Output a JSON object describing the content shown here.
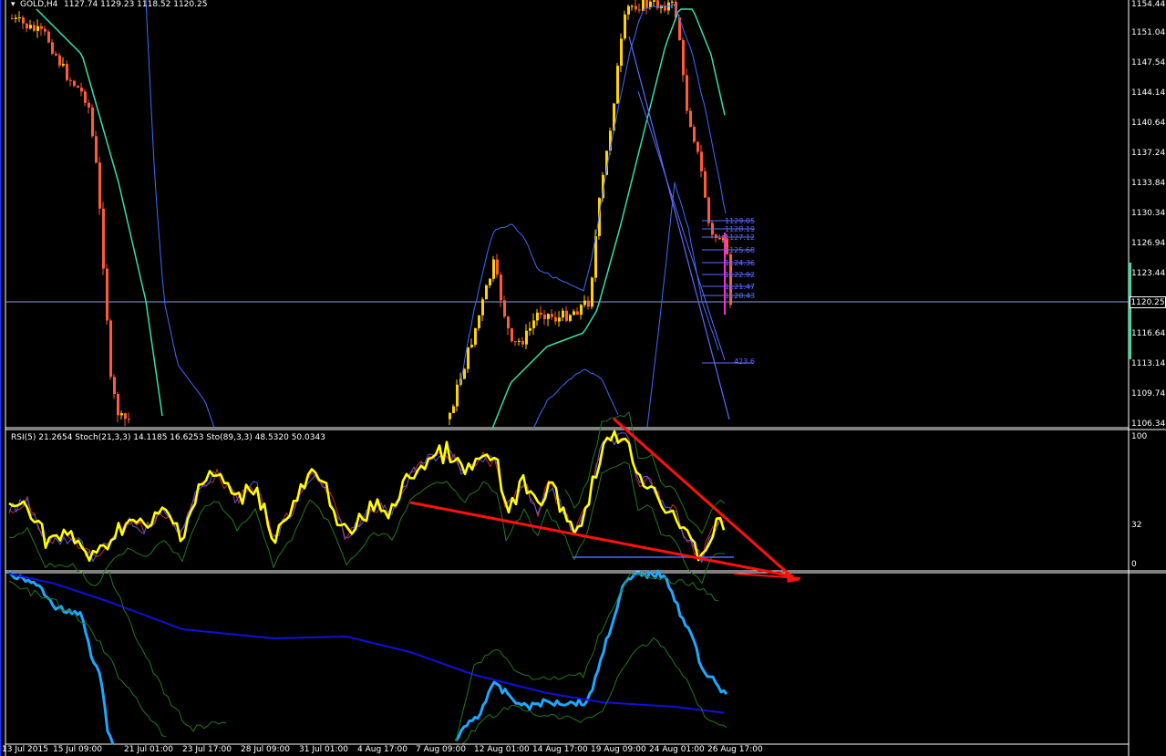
{
  "window": {
    "title": "GOLD,H4",
    "ohlc": "1127.74 1129.23 1118.52 1120.25",
    "arrow_icon": "caret-down-icon"
  },
  "price_axis": {
    "labels": [
      "1154.44",
      "1151.04",
      "1147.54",
      "1144.14",
      "1140.64",
      "1137.24",
      "1133.84",
      "1130.34",
      "1126.94",
      "1123.44",
      "1116.64",
      "1113.14",
      "1109.74",
      "1106.34"
    ],
    "current_price": "1120.25"
  },
  "oscillator_panel": {
    "title": "RSI(5) 21.2654  Stoch(21,3,3) 14.1185 16.6253  Sto(89,3,3) 48.5320 50.0343",
    "levels": [
      "100",
      "32",
      "0"
    ]
  },
  "fib_labels": [
    "1129.05",
    "1128.19",
    "1127.12",
    "1125.68",
    "1124.36",
    "1122.92",
    "1121.47",
    "1120.43",
    "423.6"
  ],
  "time_axis": {
    "labels": [
      "13 Jul 2015",
      "15 Jul 09:00",
      "21 Jul 01:00",
      "23 Jul 17:00",
      "28 Jul 09:00",
      "31 Jul 01:00",
      "4 Aug 17:00",
      "7 Aug 09:00",
      "12 Aug 01:00",
      "14 Aug 17:00",
      "19 Aug 09:00",
      "24 Aug 01:00",
      "26 Aug 17:00"
    ]
  },
  "colors": {
    "background": "#000000",
    "bull_candle": "#ffd200",
    "bear_candle": "#ff5a3c",
    "ma_green": "#36e0a8",
    "bands_blue": "#3c6cff",
    "rsi_yellow": "#ffff00",
    "trendline_red": "#ff1010",
    "lower_cyan": "#1ea8ff",
    "lower_navy": "#1010e0",
    "osc_green": "#1f7a1f"
  }
}
